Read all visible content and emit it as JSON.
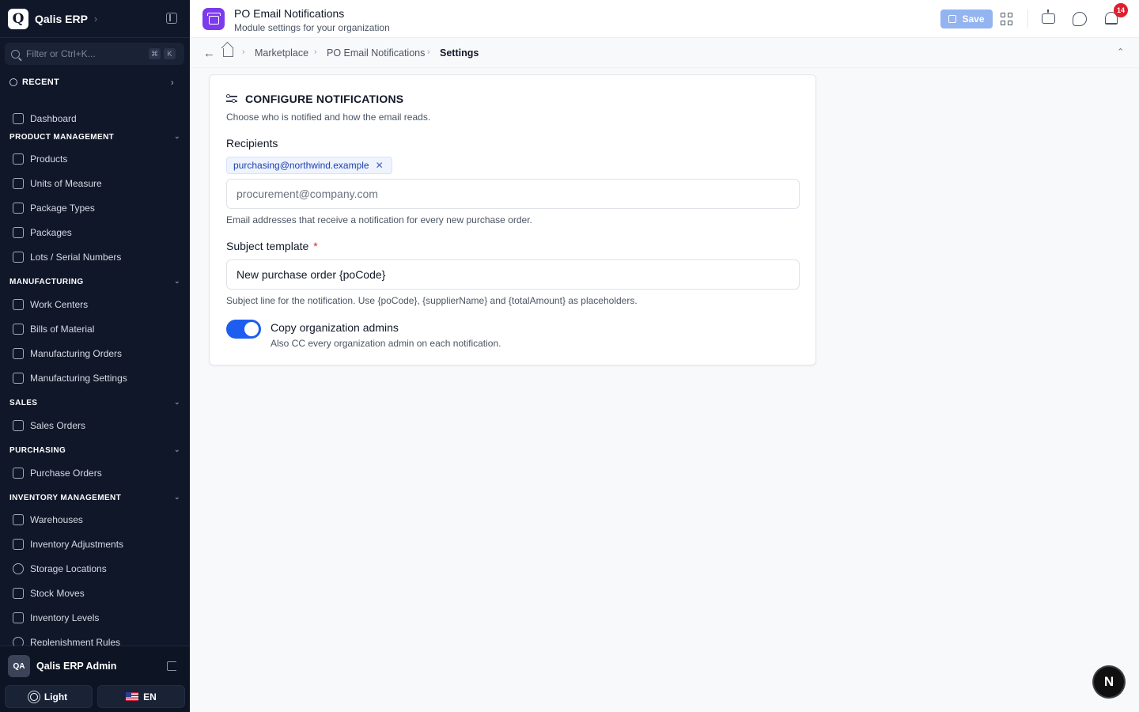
{
  "sidebar": {
    "app_logo_letter": "Q",
    "app_name": "Qalis ERP",
    "app_chevron": "›",
    "filter_placeholder": "Filter or Ctrl+K...",
    "kbd_cmd": "⌘",
    "kbd_k": "K",
    "recent_label": "RECENT",
    "dashboard": "Dashboard",
    "sections": {
      "product_management": {
        "title": "PRODUCT MANAGEMENT",
        "items": [
          "Products",
          "Units of Measure",
          "Package Types",
          "Packages",
          "Lots / Serial Numbers"
        ]
      },
      "manufacturing": {
        "title": "MANUFACTURING",
        "items": [
          "Work Centers",
          "Bills of Material",
          "Manufacturing Orders",
          "Manufacturing Settings"
        ]
      },
      "sales": {
        "title": "SALES",
        "items": [
          "Sales Orders"
        ]
      },
      "purchasing": {
        "title": "PURCHASING",
        "items": [
          "Purchase Orders"
        ]
      },
      "inventory_management": {
        "title": "INVENTORY MANAGEMENT",
        "items": [
          "Warehouses",
          "Inventory Adjustments",
          "Storage Locations",
          "Stock Moves",
          "Inventory Levels",
          "Replenishment Rules"
        ]
      }
    },
    "footer": {
      "user_initials": "QA",
      "user_name": "Qalis ERP Admin",
      "theme_label": "Light",
      "lang_label": "EN"
    }
  },
  "topbar": {
    "title": "PO Email Notifications",
    "subtitle": "Module settings for your organization",
    "save_label": "Save",
    "notification_count": "14"
  },
  "breadcrumb": {
    "items": [
      "Marketplace",
      "PO Email Notifications",
      "Settings"
    ]
  },
  "form": {
    "title": "CONFIGURE NOTIFICATIONS",
    "subtitle": "Choose who is notified and how the email reads.",
    "recipients": {
      "label": "Recipients",
      "chips": [
        "purchasing@northwind.example"
      ],
      "placeholder": "procurement@company.com",
      "help": "Email addresses that receive a notification for every new purchase order."
    },
    "subject": {
      "label": "Subject template",
      "required_mark": "*",
      "value": "New purchase order {poCode}",
      "help": "Subject line for the notification. Use {poCode}, {supplierName} and {totalAmount} as placeholders."
    },
    "copy_admins": {
      "label": "Copy organization admins",
      "help": "Also CC every organization admin on each notification.",
      "enabled": true
    }
  },
  "fab": {
    "label": "N"
  },
  "colors": {
    "sidebar_bg": "#101729",
    "accent": "#1d5ef0",
    "module_icon": "#7c3aed",
    "badge": "#e11d2e"
  }
}
